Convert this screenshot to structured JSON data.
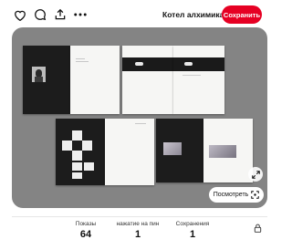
{
  "toolbar": {
    "board_name": "Котел алхимика",
    "save_label": "Сохранить",
    "icons": [
      "heart-icon",
      "comment-icon",
      "share-icon",
      "more-icon",
      "chevron-down-icon"
    ],
    "accent_color": "#e60023"
  },
  "image": {
    "background_color": "#848484",
    "view_label": "Посмотреть",
    "icons": [
      "expand-icon",
      "visual-search-icon"
    ]
  },
  "stats": [
    {
      "label": "Показы",
      "value": "64"
    },
    {
      "label": "нажатие на пин",
      "value": "1"
    },
    {
      "label": "Сохранения",
      "value": "1"
    }
  ],
  "stats_icon": "lock-icon"
}
